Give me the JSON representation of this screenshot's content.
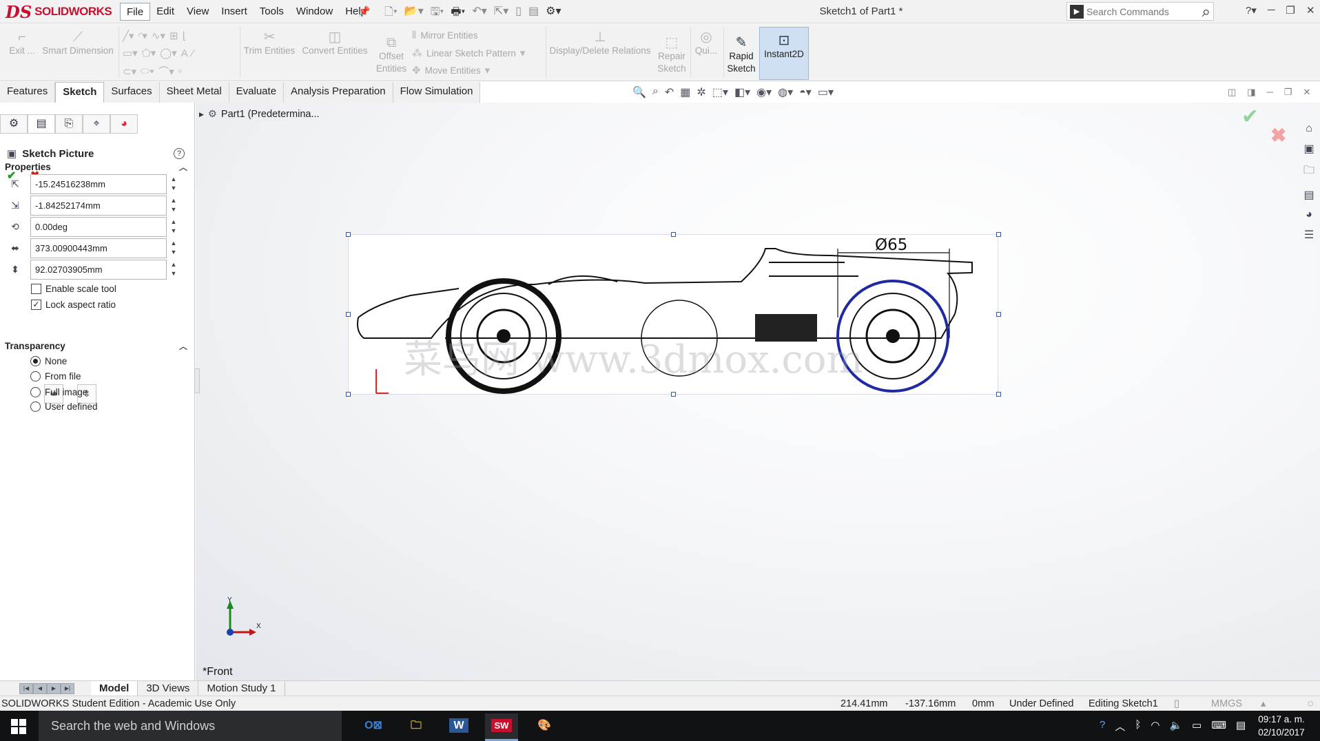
{
  "app": {
    "brand_mark": "DS",
    "brand_name": "SOLIDWORKS",
    "window_title": "Sketch1 of Part1 *"
  },
  "menu": [
    "File",
    "Edit",
    "View",
    "Insert",
    "Tools",
    "Window",
    "Help"
  ],
  "search": {
    "placeholder": "Search Commands"
  },
  "command_manager": {
    "exit_sketch": "Exit ...",
    "smart_dimension": "Smart Dimension",
    "trim_entities": "Trim Entities",
    "convert_entities": "Convert Entities",
    "offset_entities_1": "Offset",
    "offset_entities_2": "Entities",
    "mirror_entities": "Mirror Entities",
    "linear_sketch_pattern": "Linear Sketch Pattern",
    "move_entities": "Move Entities",
    "display_delete_relations": "Display/Delete Relations",
    "repair_sketch_1": "Repair",
    "repair_sketch_2": "Sketch",
    "quick_snaps": "Qui...",
    "rapid_sketch_1": "Rapid",
    "rapid_sketch_2": "Sketch",
    "instant2d": "Instant2D"
  },
  "tabs": [
    "Features",
    "Sketch",
    "Surfaces",
    "Sheet Metal",
    "Evaluate",
    "Analysis Preparation",
    "Flow Simulation"
  ],
  "active_tab": "Sketch",
  "property_manager": {
    "title": "Sketch Picture",
    "help": "?",
    "properties_header": "Properties",
    "x_position": "-15.24516238mm",
    "y_position": "-1.84252174mm",
    "angle": "0.00deg",
    "width": "373.00900443mm",
    "height": "92.02703905mm",
    "enable_scale_tool": "Enable scale tool",
    "lock_aspect_ratio": "Lock aspect ratio",
    "lock_aspect_ratio_checked": true,
    "transparency_header": "Transparency",
    "transparency_options": [
      "None",
      "From file",
      "Full image",
      "User defined"
    ],
    "transparency_selected": "None"
  },
  "feature_tree": {
    "root": "Part1  (Predetermina..."
  },
  "viewport": {
    "dimension_label": "Ø65",
    "watermark": "菜鸟网 www.3dmox.com",
    "view_name": "*Front",
    "axis_x": "X",
    "axis_y": "Y"
  },
  "bottom_tabs": [
    "Model",
    "3D Views",
    "Motion Study 1"
  ],
  "status_bar": {
    "edition": "SOLIDWORKS Student Edition - Academic Use Only",
    "x_coord": "214.41mm",
    "y_coord": "-137.16mm",
    "z_coord": "0mm",
    "sketch_state": "Under Defined",
    "editing": "Editing Sketch1",
    "units": "MMGS"
  },
  "taskbar": {
    "search_placeholder": "Search the web and Windows",
    "apps": [
      "Outlook",
      "File Explorer",
      "Word",
      "SOLIDWORKS",
      "Paint"
    ],
    "active_app": "SOLIDWORKS",
    "time": "09:17 a. m.",
    "date": "02/10/2017"
  },
  "colors": {
    "brand_red": "#c8102e",
    "selection_blue": "#2e5aa5",
    "accept_green": "#1d9a2b",
    "reject_red": "#d01b1b"
  }
}
